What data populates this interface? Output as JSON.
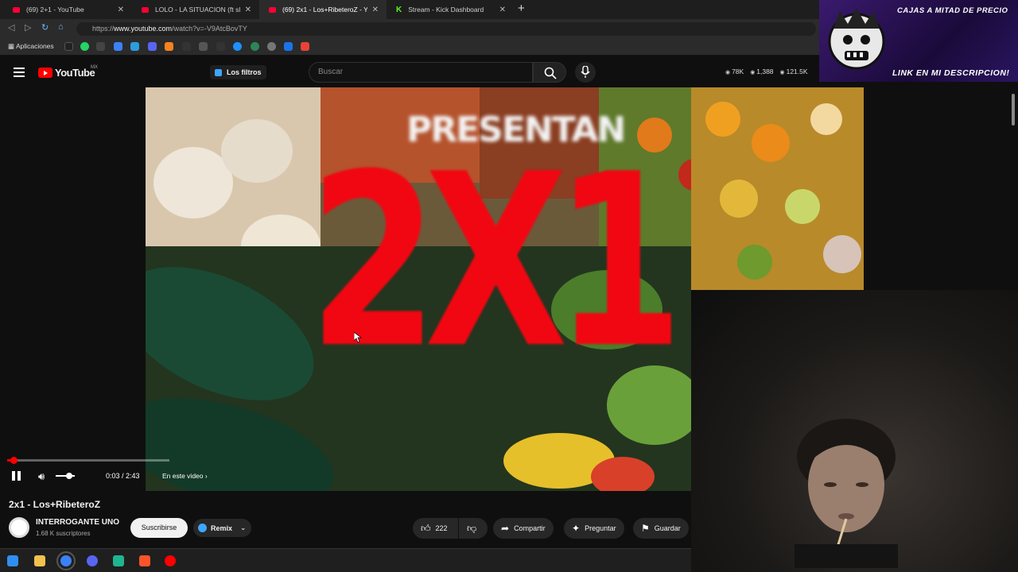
{
  "browser": {
    "tabs": [
      {
        "title": "(69) 2+1 - YouTube"
      },
      {
        "title": "LOLO - LA SITUACION (ft slimes"
      },
      {
        "title": "(69) 2x1 - Los+RibeteroZ - Y"
      },
      {
        "title": "Stream - Kick Dashboard"
      }
    ],
    "url_prefix": "https://",
    "url_host": "www.youtube.com",
    "url_path": "/watch?v=-V9AtcBovTY",
    "bookmarks_label": "Aplicaciones"
  },
  "overlay": {
    "top_text": "CAJAS A MITAD DE PRECIO",
    "bottom_text": "LINK EN MI DESCRIPCION!"
  },
  "youtube": {
    "logo_text": "YouTube",
    "country": "MX",
    "filters_label": "Los filtros",
    "search_placeholder": "Buscar",
    "stats": [
      "78K",
      "1,388",
      "121.5K"
    ]
  },
  "player": {
    "overlay_top_text": "PRESENTAN",
    "overlay_big_text": "2X1",
    "time": "0:03 / 2:43",
    "chapter": "En este video",
    "progress": 0.019,
    "volume": 0.7
  },
  "video_info": {
    "title": "2x1 - Los+RibeteroZ",
    "channel": "INTERROGANTE UNO",
    "subscribers": "1.68 K suscriptores",
    "subscribe_label": "Suscribirse",
    "remix_label": "Remix",
    "likes": "222",
    "share_label": "Compartir",
    "ask_label": "Preguntar",
    "save_label": "Guardar"
  },
  "colors": {
    "accent_red": "#ff0000",
    "kick_green": "#53fc18"
  }
}
